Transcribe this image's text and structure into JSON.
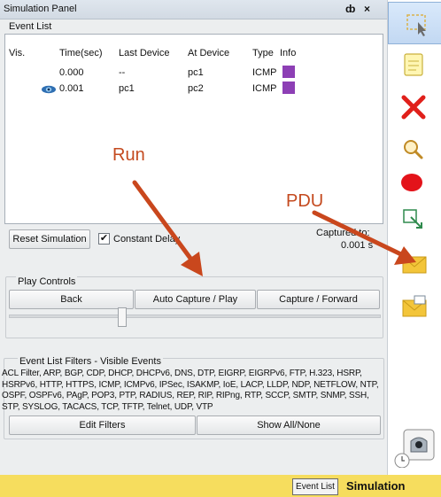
{
  "panel": {
    "title": "Simulation Panel",
    "pin_glyph": "ȸ",
    "close_glyph": "×"
  },
  "event_list": {
    "label": "Event List",
    "columns": [
      "Vis.",
      "Time(sec)",
      "Last Device",
      "At Device",
      "Type",
      "Info"
    ],
    "rows": [
      {
        "visible": false,
        "time": "0.000",
        "last_device": "--",
        "at_device": "pc1",
        "type": "ICMP",
        "info_color": "#8d3fb5"
      },
      {
        "visible": true,
        "time": "0.001",
        "last_device": "pc1",
        "at_device": "pc2",
        "type": "ICMP",
        "info_color": "#8d3fb5"
      }
    ]
  },
  "controls": {
    "reset_label": "Reset Simulation",
    "constant_delay_label": "Constant Delay",
    "constant_delay_checked": true,
    "checkmark": "✔",
    "captured_to_label": "Captured to:",
    "captured_to_value": "0.001 s"
  },
  "play_controls": {
    "label": "Play Controls",
    "back_label": "Back",
    "auto_capture_label": "Auto Capture / Play",
    "capture_forward_label": "Capture / Forward",
    "speed_level": 0.3
  },
  "filters": {
    "label": "Event List Filters - Visible Events",
    "text": "ACL Filter, ARP, BGP, CDP, DHCP, DHCPv6, DNS, DTP, EIGRP, EIGRPv6, FTP, H.323, HSRP, HSRPv6, HTTP, HTTPS, ICMP, ICMPv6, IPSec, ISAKMP, IoE, LACP, LLDP, NDP, NETFLOW, NTP, OSPF, OSPFv6, PAgP, POP3, PTP, RADIUS, REP, RIP, RIPng, RTP, SCCP, SMTP, SNMP, SSH, STP, SYSLOG, TACACS, TCP, TFTP, Telnet, UDP, VTP",
    "edit_label": "Edit Filters",
    "show_all_label": "Show All/None"
  },
  "annotations": {
    "run_label": "Run",
    "pdu_label": "PDU",
    "arrow_color": "#c9471d"
  },
  "toolbar": {
    "tools": [
      "select-icon",
      "note-icon",
      "delete-icon",
      "inspect-icon",
      "draw-ellipse-icon",
      "resize-icon",
      "simple-pdu-icon",
      "complex-pdu-icon"
    ]
  },
  "bottom": {
    "event_list_tab": "Event List",
    "mode_label": "Simulation",
    "strip_color": "#f6dd5e"
  }
}
